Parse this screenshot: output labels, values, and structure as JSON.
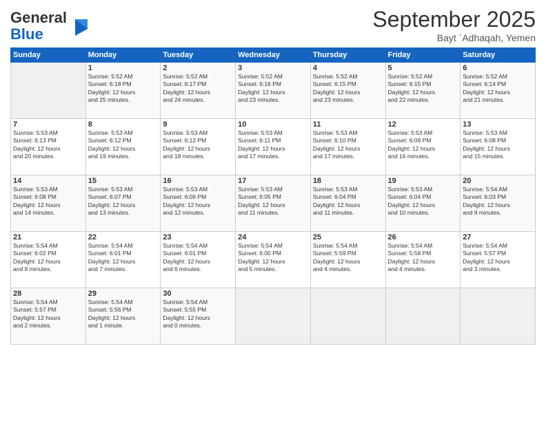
{
  "logo": {
    "general": "General",
    "blue": "Blue"
  },
  "title": "September 2025",
  "subtitle": "Bayt `Adhaqah, Yemen",
  "days_header": [
    "Sunday",
    "Monday",
    "Tuesday",
    "Wednesday",
    "Thursday",
    "Friday",
    "Saturday"
  ],
  "weeks": [
    [
      {
        "day": "",
        "info": ""
      },
      {
        "day": "1",
        "info": "Sunrise: 5:52 AM\nSunset: 6:18 PM\nDaylight: 12 hours\nand 25 minutes."
      },
      {
        "day": "2",
        "info": "Sunrise: 5:52 AM\nSunset: 6:17 PM\nDaylight: 12 hours\nand 24 minutes."
      },
      {
        "day": "3",
        "info": "Sunrise: 5:52 AM\nSunset: 6:16 PM\nDaylight: 12 hours\nand 23 minutes."
      },
      {
        "day": "4",
        "info": "Sunrise: 5:52 AM\nSunset: 6:15 PM\nDaylight: 12 hours\nand 23 minutes."
      },
      {
        "day": "5",
        "info": "Sunrise: 5:52 AM\nSunset: 6:15 PM\nDaylight: 12 hours\nand 22 minutes."
      },
      {
        "day": "6",
        "info": "Sunrise: 5:52 AM\nSunset: 6:14 PM\nDaylight: 12 hours\nand 21 minutes."
      }
    ],
    [
      {
        "day": "7",
        "info": "Sunrise: 5:53 AM\nSunset: 6:13 PM\nDaylight: 12 hours\nand 20 minutes."
      },
      {
        "day": "8",
        "info": "Sunrise: 5:53 AM\nSunset: 6:12 PM\nDaylight: 12 hours\nand 19 minutes."
      },
      {
        "day": "9",
        "info": "Sunrise: 5:53 AM\nSunset: 6:12 PM\nDaylight: 12 hours\nand 18 minutes."
      },
      {
        "day": "10",
        "info": "Sunrise: 5:53 AM\nSunset: 6:11 PM\nDaylight: 12 hours\nand 17 minutes."
      },
      {
        "day": "11",
        "info": "Sunrise: 5:53 AM\nSunset: 6:10 PM\nDaylight: 12 hours\nand 17 minutes."
      },
      {
        "day": "12",
        "info": "Sunrise: 5:53 AM\nSunset: 6:09 PM\nDaylight: 12 hours\nand 16 minutes."
      },
      {
        "day": "13",
        "info": "Sunrise: 5:53 AM\nSunset: 6:08 PM\nDaylight: 12 hours\nand 15 minutes."
      }
    ],
    [
      {
        "day": "14",
        "info": "Sunrise: 5:53 AM\nSunset: 6:08 PM\nDaylight: 12 hours\nand 14 minutes."
      },
      {
        "day": "15",
        "info": "Sunrise: 5:53 AM\nSunset: 6:07 PM\nDaylight: 12 hours\nand 13 minutes."
      },
      {
        "day": "16",
        "info": "Sunrise: 5:53 AM\nSunset: 6:06 PM\nDaylight: 12 hours\nand 12 minutes."
      },
      {
        "day": "17",
        "info": "Sunrise: 5:53 AM\nSunset: 6:05 PM\nDaylight: 12 hours\nand 11 minutes."
      },
      {
        "day": "18",
        "info": "Sunrise: 5:53 AM\nSunset: 6:04 PM\nDaylight: 12 hours\nand 11 minutes."
      },
      {
        "day": "19",
        "info": "Sunrise: 5:53 AM\nSunset: 6:04 PM\nDaylight: 12 hours\nand 10 minutes."
      },
      {
        "day": "20",
        "info": "Sunrise: 5:54 AM\nSunset: 6:03 PM\nDaylight: 12 hours\nand 9 minutes."
      }
    ],
    [
      {
        "day": "21",
        "info": "Sunrise: 5:54 AM\nSunset: 6:02 PM\nDaylight: 12 hours\nand 8 minutes."
      },
      {
        "day": "22",
        "info": "Sunrise: 5:54 AM\nSunset: 6:01 PM\nDaylight: 12 hours\nand 7 minutes."
      },
      {
        "day": "23",
        "info": "Sunrise: 5:54 AM\nSunset: 6:01 PM\nDaylight: 12 hours\nand 6 minutes."
      },
      {
        "day": "24",
        "info": "Sunrise: 5:54 AM\nSunset: 6:00 PM\nDaylight: 12 hours\nand 5 minutes."
      },
      {
        "day": "25",
        "info": "Sunrise: 5:54 AM\nSunset: 5:59 PM\nDaylight: 12 hours\nand 4 minutes."
      },
      {
        "day": "26",
        "info": "Sunrise: 5:54 AM\nSunset: 5:58 PM\nDaylight: 12 hours\nand 4 minutes."
      },
      {
        "day": "27",
        "info": "Sunrise: 5:54 AM\nSunset: 5:57 PM\nDaylight: 12 hours\nand 3 minutes."
      }
    ],
    [
      {
        "day": "28",
        "info": "Sunrise: 5:54 AM\nSunset: 5:57 PM\nDaylight: 12 hours\nand 2 minutes."
      },
      {
        "day": "29",
        "info": "Sunrise: 5:54 AM\nSunset: 5:56 PM\nDaylight: 12 hours\nand 1 minute."
      },
      {
        "day": "30",
        "info": "Sunrise: 5:54 AM\nSunset: 5:55 PM\nDaylight: 12 hours\nand 0 minutes."
      },
      {
        "day": "",
        "info": ""
      },
      {
        "day": "",
        "info": ""
      },
      {
        "day": "",
        "info": ""
      },
      {
        "day": "",
        "info": ""
      }
    ]
  ]
}
